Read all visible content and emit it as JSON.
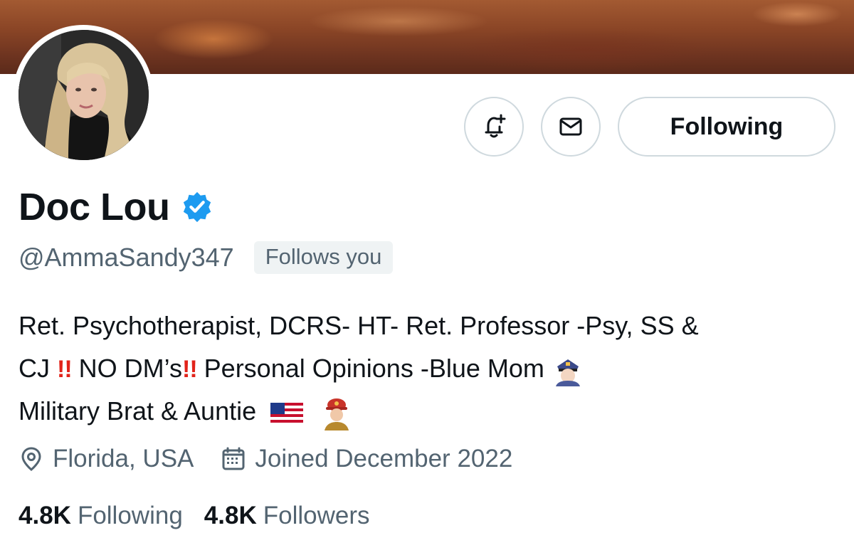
{
  "profile": {
    "display_name": "Doc Lou",
    "handle": "@AmmaSandy347",
    "follows_you": "Follows you",
    "bio": {
      "line1": "Ret. Psychotherapist, DCRS- HT- Ret. Professor -Psy, SS &",
      "line2_a": "CJ ",
      "line2_b": " NO DM’s",
      "line2_c": " Personal Opinions -Blue Mom",
      "line3": "Military Brat & Auntie",
      "exclamation": "!!"
    },
    "location": "Florida, USA",
    "joined": "Joined December 2022"
  },
  "actions": {
    "following_label": "Following"
  },
  "stats": {
    "following_count": "4.8K",
    "following_label": "Following",
    "followers_count": "4.8K",
    "followers_label": "Followers"
  },
  "icons": {
    "notify": "bell-plus-icon",
    "message": "envelope-icon",
    "verified": "verified-badge-icon",
    "location": "location-pin-icon",
    "calendar": "calendar-icon",
    "police": "police-officer-emoji",
    "flag": "us-flag-emoji",
    "firefighter": "firefighter-emoji"
  },
  "colors": {
    "verified_blue": "#1d9bf0",
    "text_primary": "#0f1419",
    "text_secondary": "#536471",
    "border": "#cfd9de",
    "exclamation_red": "#e2231a"
  }
}
